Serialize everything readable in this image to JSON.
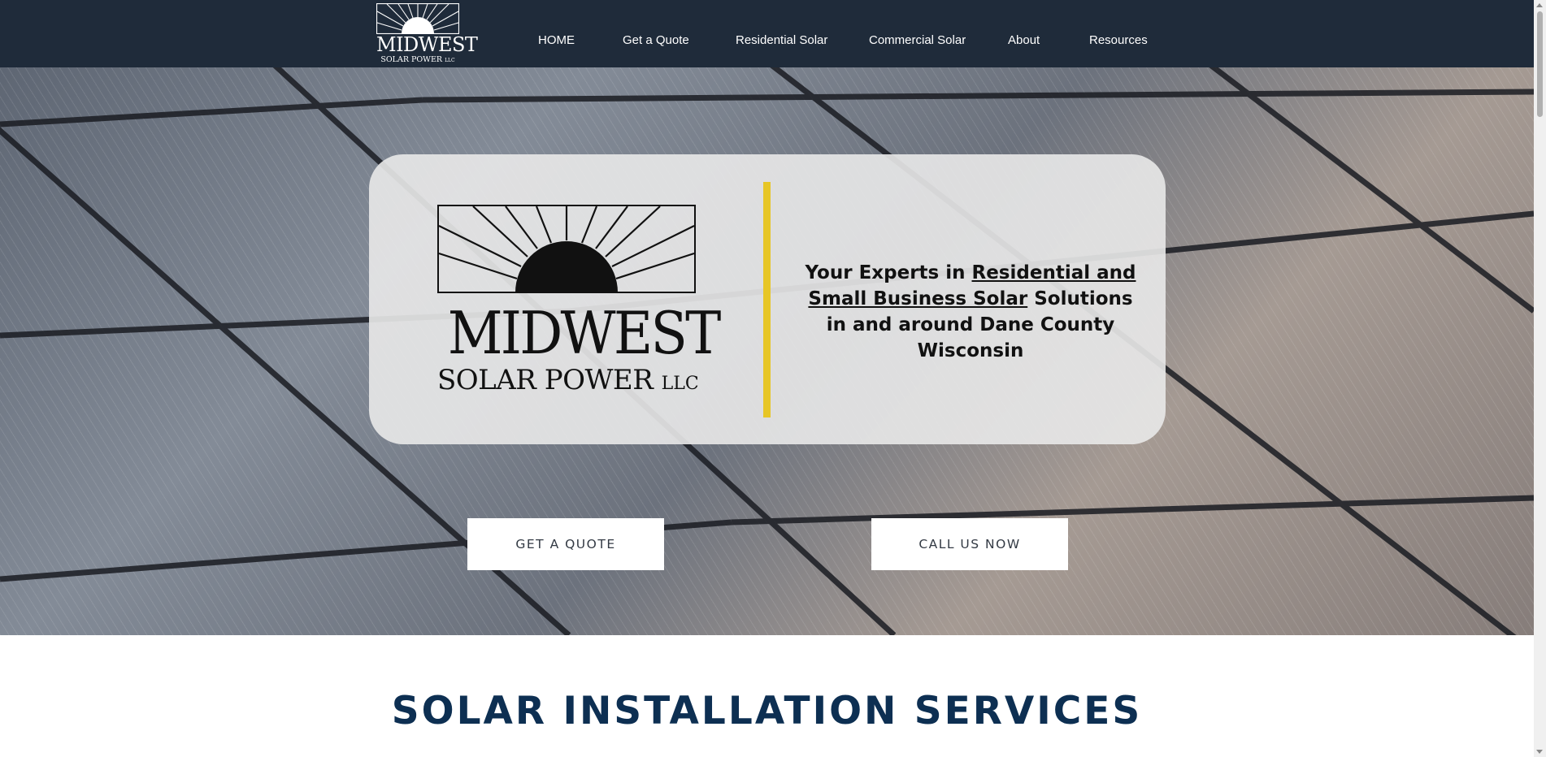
{
  "brand": {
    "name_line1": "MIDWEST",
    "name_line2": "SOLAR POWER",
    "suffix": "LLC"
  },
  "nav": {
    "items": [
      "HOME",
      "Get a Quote",
      "Residential Solar",
      "Commercial Solar",
      "About",
      "Resources"
    ]
  },
  "hero": {
    "tagline_pre": "Your Experts in ",
    "tagline_link": "Residential and Small Business Solar",
    "tagline_post": " Solutions in and around Dane County Wisconsin",
    "accent_color": "#e7c626",
    "buttons": {
      "quote": "GET A QUOTE",
      "call": "CALL US NOW"
    }
  },
  "section": {
    "title": "SOLAR INSTALLATION SERVICES"
  },
  "colors": {
    "header_bg": "#1f2b3a",
    "title_color": "#0d2f52"
  }
}
